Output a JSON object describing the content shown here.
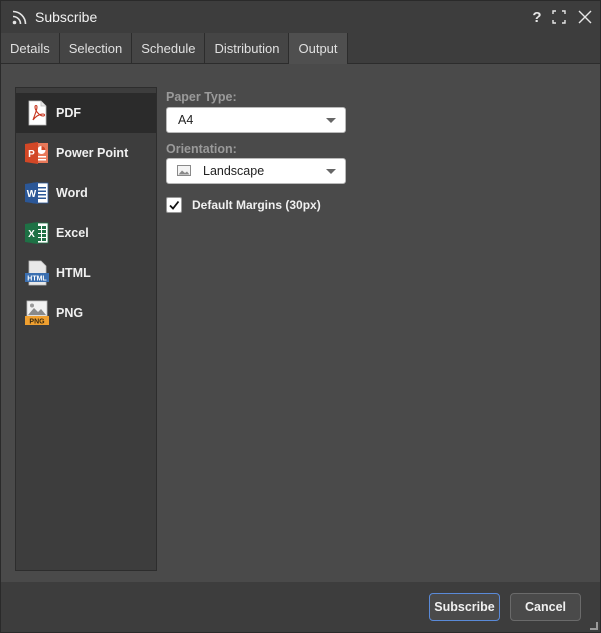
{
  "window": {
    "title": "Subscribe",
    "help_glyph": "?"
  },
  "tabs": [
    {
      "label": "Details"
    },
    {
      "label": "Selection"
    },
    {
      "label": "Schedule"
    },
    {
      "label": "Distribution"
    },
    {
      "label": "Output",
      "active": true
    }
  ],
  "formats": [
    {
      "label": "PDF",
      "icon": "pdf-icon",
      "selected": true
    },
    {
      "label": "Power Point",
      "icon": "powerpoint-icon"
    },
    {
      "label": "Word",
      "icon": "word-icon"
    },
    {
      "label": "Excel",
      "icon": "excel-icon"
    },
    {
      "label": "HTML",
      "icon": "html-icon",
      "icon_text": "HTML"
    },
    {
      "label": "PNG",
      "icon": "png-icon",
      "icon_text": "PNG"
    }
  ],
  "options": {
    "paper_type_label": "Paper Type:",
    "paper_type_value": "A4",
    "orientation_label": "Orientation:",
    "orientation_value": "Landscape",
    "margins_label": "Default Margins (30px)",
    "margins_checked": true
  },
  "footer": {
    "subscribe_label": "Subscribe",
    "cancel_label": "Cancel"
  },
  "colors": {
    "accent_border": "#5a8ad8",
    "pdf_red": "#c7361f",
    "ppt_orange": "#d24726",
    "word_blue": "#2b5797",
    "excel_green": "#1e7145",
    "html_blue": "#3b6fb0",
    "png_orange": "#f0a030"
  }
}
